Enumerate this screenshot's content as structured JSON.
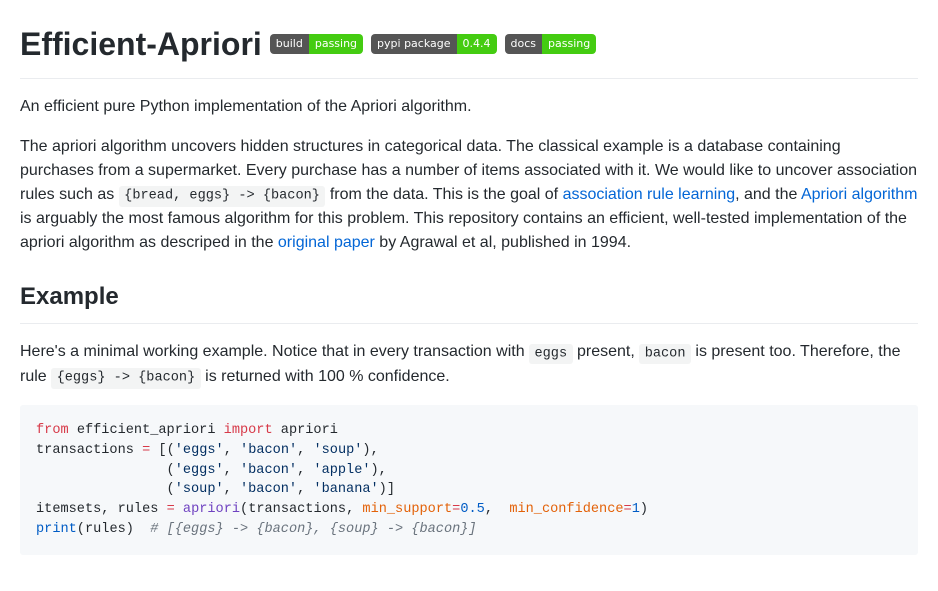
{
  "title": "Efficient-Apriori",
  "badges": [
    {
      "left": "build",
      "right": "passing",
      "color": "#4c1"
    },
    {
      "left": "pypi package",
      "right": "0.4.4",
      "color": "#4c1"
    },
    {
      "left": "docs",
      "right": "passing",
      "color": "#4c1"
    }
  ],
  "intro": "An efficient pure Python implementation of the Apriori algorithm.",
  "desc": {
    "part1": "The apriori algorithm uncovers hidden structures in categorical data. The classical example is a database containing purchases from a supermarket. Every purchase has a number of items associated with it. We would like to uncover association rules such as ",
    "code1": "{bread, eggs} -> {bacon}",
    "part2": " from the data. This is the goal of ",
    "link1": "association rule learning",
    "part3": ", and the ",
    "link2": "Apriori algorithm",
    "part4": " is arguably the most famous algorithm for this problem. This repository contains an efficient, well-tested implementation of the apriori algorithm as descriped in the ",
    "link3": "original paper",
    "part5": " by Agrawal et al, published in 1994."
  },
  "example_heading": "Example",
  "example_para": {
    "part1": "Here's a minimal working example. Notice that in every transaction with ",
    "code1": "eggs",
    "part2": " present, ",
    "code2": "bacon",
    "part3": " is present too. Therefore, the rule ",
    "code3": "{eggs} -> {bacon}",
    "part4": " is returned with 100 % confidence."
  },
  "code": {
    "kw_from": "from",
    "mod": "efficient_apriori",
    "kw_import": "import",
    "imp_name": "apriori",
    "var_transactions": "transactions",
    "eq": "=",
    "lb": "[(",
    "s_eggs": "'eggs'",
    "s_bacon": "'bacon'",
    "s_soup": "'soup'",
    "s_apple": "'apple'",
    "s_banana": "'banana'",
    "comma": ", ",
    "row_end": "),",
    "row_start": "                (",
    "row_last_end": ")]",
    "var_itemsets": "itemsets",
    "var_rules": "rules",
    "fn_apriori": "apriori",
    "lp": "(",
    "rp": ")",
    "arg_min_support": "min_support",
    "val_05": "0.5",
    "arg_min_confidence": "min_confidence",
    "val_1": "1",
    "fn_print": "print",
    "comment": "# [{eggs} -> {bacon}, {soup} -> {bacon}]"
  }
}
